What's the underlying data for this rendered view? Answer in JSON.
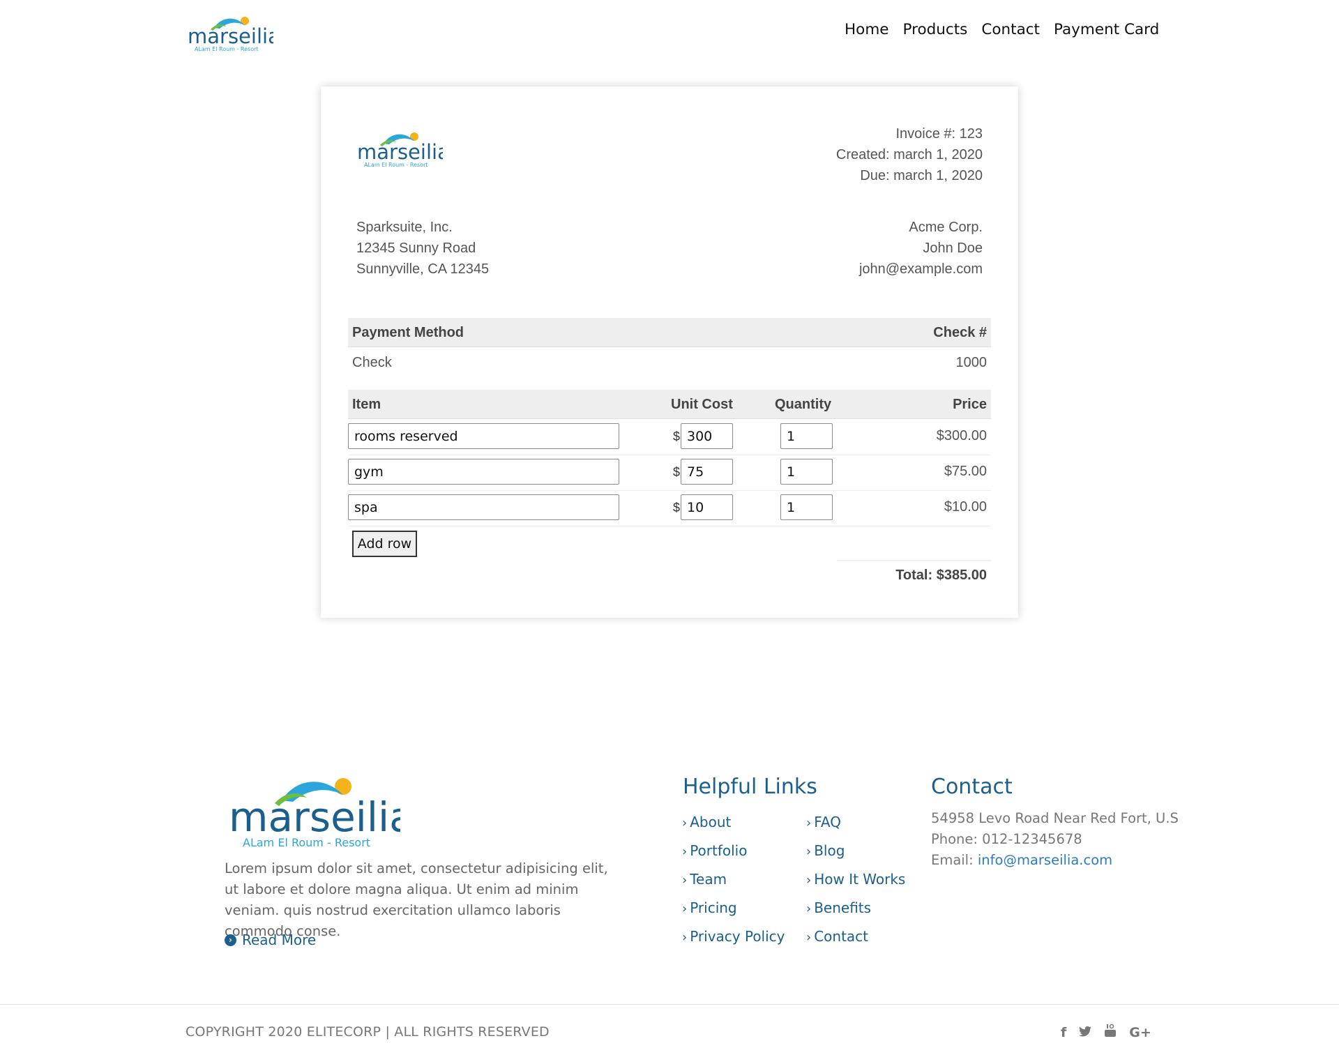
{
  "brand": {
    "name": "marseilia",
    "tagline": "ALam El Roum - Resort",
    "primary": "#1b5f8e",
    "accent": "#f5b21a",
    "wave": "#2aa6dc",
    "leaf": "#6cbf3f"
  },
  "nav": {
    "items": [
      "Home",
      "Products",
      "Contact",
      "Payment Card"
    ]
  },
  "invoice": {
    "number": "Invoice #: 123",
    "created": "Created: march 1, 2020",
    "due": "Due: march 1, 2020",
    "from": [
      "Sparksuite, Inc.",
      "12345 Sunny Road",
      "Sunnyville, CA 12345"
    ],
    "to": [
      "Acme Corp.",
      "John Doe",
      "john@example.com"
    ],
    "payment_heading": {
      "method": "Payment Method",
      "check": "Check #"
    },
    "payment_details": {
      "method": "Check",
      "check": "1000"
    },
    "items_heading": {
      "item": "Item",
      "unit_cost": "Unit Cost",
      "quantity": "Quantity",
      "price": "Price"
    },
    "currency_symbol": "$",
    "items": [
      {
        "name": "rooms reserved",
        "unit_cost": "300",
        "quantity": "1",
        "price": "$300.00"
      },
      {
        "name": "gym",
        "unit_cost": "75",
        "quantity": "1",
        "price": "$75.00"
      },
      {
        "name": "spa",
        "unit_cost": "10",
        "quantity": "1",
        "price": "$10.00"
      }
    ],
    "add_row_label": "Add row",
    "total": "Total: $385.00"
  },
  "footer": {
    "about": "Lorem ipsum dolor sit amet, consectetur adipisicing elit, ut labore et dolore magna aliqua. Ut enim ad minim veniam. quis nostrud exercitation ullamco laboris commodo conse.",
    "read_more": "Read More",
    "links_heading": "Helpful Links",
    "links_col1": [
      "About",
      "Portfolio",
      "Team",
      "Pricing",
      "Privacy Policy"
    ],
    "links_col2": [
      "FAQ",
      "Blog",
      "How It Works",
      "Benefits",
      "Contact"
    ],
    "contact_heading": "Contact",
    "address": "54958 Levo Road Near Red Fort, U.S",
    "phone": "Phone: 012-12345678",
    "email_label": "Email: ",
    "email": "info@marseilia.com",
    "copyright": "COPYRIGHT 2020 ELITECORP | ALL RIGHTS RESERVED",
    "social": [
      "facebook-icon",
      "twitter-icon",
      "youtube-icon",
      "google-plus-icon"
    ]
  }
}
